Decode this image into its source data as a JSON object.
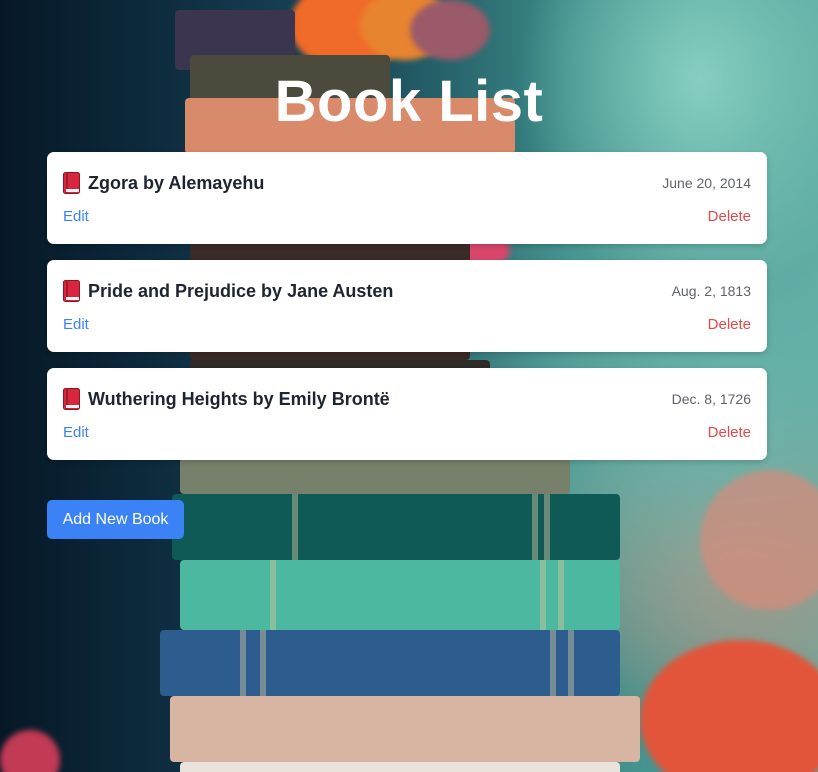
{
  "page": {
    "title": "Book List"
  },
  "books": [
    {
      "title": "Zgora by Alemayehu",
      "date": "June 20, 2014",
      "edit_label": "Edit",
      "delete_label": "Delete",
      "icon": "red-book-icon"
    },
    {
      "title": "Pride and Prejudice by Jane Austen",
      "date": "Aug. 2, 1813",
      "edit_label": "Edit",
      "delete_label": "Delete",
      "icon": "red-book-icon"
    },
    {
      "title": "Wuthering Heights by Emily Brontë",
      "date": "Dec. 8, 1726",
      "edit_label": "Edit",
      "delete_label": "Delete",
      "icon": "red-book-icon"
    }
  ],
  "actions": {
    "add_label": "Add New Book"
  },
  "colors": {
    "primary": "#3b82f6",
    "danger": "#e0484a",
    "card_bg": "#ffffff",
    "title_text": "#ffffff"
  }
}
